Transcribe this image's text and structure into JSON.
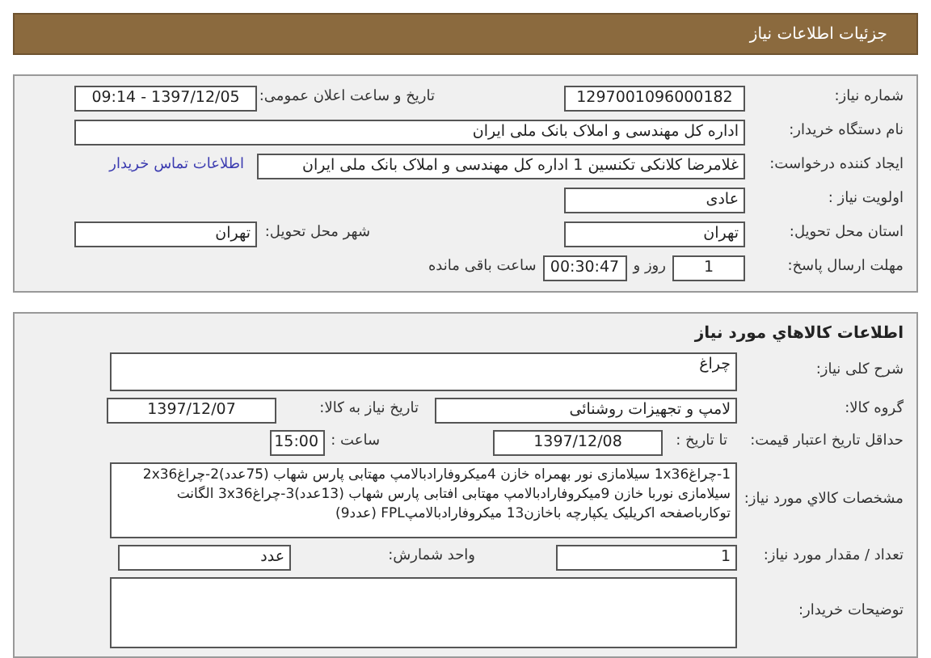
{
  "header": {
    "title": "جزئیات اطلاعات نیاز"
  },
  "need_info": {
    "need_number": {
      "label": "شماره نیاز:",
      "value": "1297001096000182"
    },
    "announce_date": {
      "label": "تاریخ و ساعت اعلان عمومی:",
      "value": "1397/12/05 - 09:14"
    },
    "buyer_org": {
      "label": "نام دستگاه خریدار:",
      "value": "اداره کل مهندسی و املاک بانک ملی ایران"
    },
    "requester": {
      "label": "ایجاد کننده درخواست:",
      "value": "غلامرضا کلانکی تکنسین 1 اداره کل مهندسی و املاک بانک ملی ایران"
    },
    "contact_link": "اطلاعات تماس خریدار",
    "priority": {
      "label": "اولویت نیاز :",
      "value": "عادی"
    },
    "province": {
      "label": "استان محل تحویل:",
      "value": "تهران"
    },
    "city": {
      "label": "شهر محل تحویل:",
      "value": "تهران"
    },
    "deadline": {
      "label": "مهلت ارسال پاسخ:",
      "days": "1",
      "days_suffix": "روز و",
      "time": "00:30:47",
      "time_suffix": "ساعت باقی مانده"
    }
  },
  "goods": {
    "title": "اطلاعات كالاهاي مورد نياز",
    "description": {
      "label": "شرح کلی نیاز:",
      "value": "چراغ"
    },
    "group": {
      "label": "گروه کالا:",
      "value": "لامپ و تجهیزات روشنائی"
    },
    "need_date": {
      "label": "تاریخ نیاز به کالا:",
      "value": "1397/12/07"
    },
    "price_validity": {
      "label": "حداقل تاریخ اعتبار قیمت:",
      "to_date_label": "تا تاریخ :",
      "date": "1397/12/08",
      "time_label": "ساعت :",
      "time": "15:00"
    },
    "specs": {
      "label": "مشخصات كالاي مورد نياز:",
      "value": "1-چراغ1x36 سیلامازی نور بهمراه خازن 4میکروفارادبالامپ مهتابی پارس شهاب (75عدد)2-چراغ2x36 سیلامازی نوربا خازن 9میکروفارادبالامپ مهتابی افتابی پارس شهاب (13عدد)3-چراغ3x36 الگانت توکارباصفحه اکریلیک یکپارچه باخازن13 میکروفارادبالامپFPL (عدد9)"
    },
    "quantity": {
      "label": "تعداد / مقدار مورد نیاز:",
      "value": "1"
    },
    "unit": {
      "label": "واحد شمارش:",
      "value": "عدد"
    },
    "buyer_notes": {
      "label": "توضیحات خریدار:"
    }
  }
}
